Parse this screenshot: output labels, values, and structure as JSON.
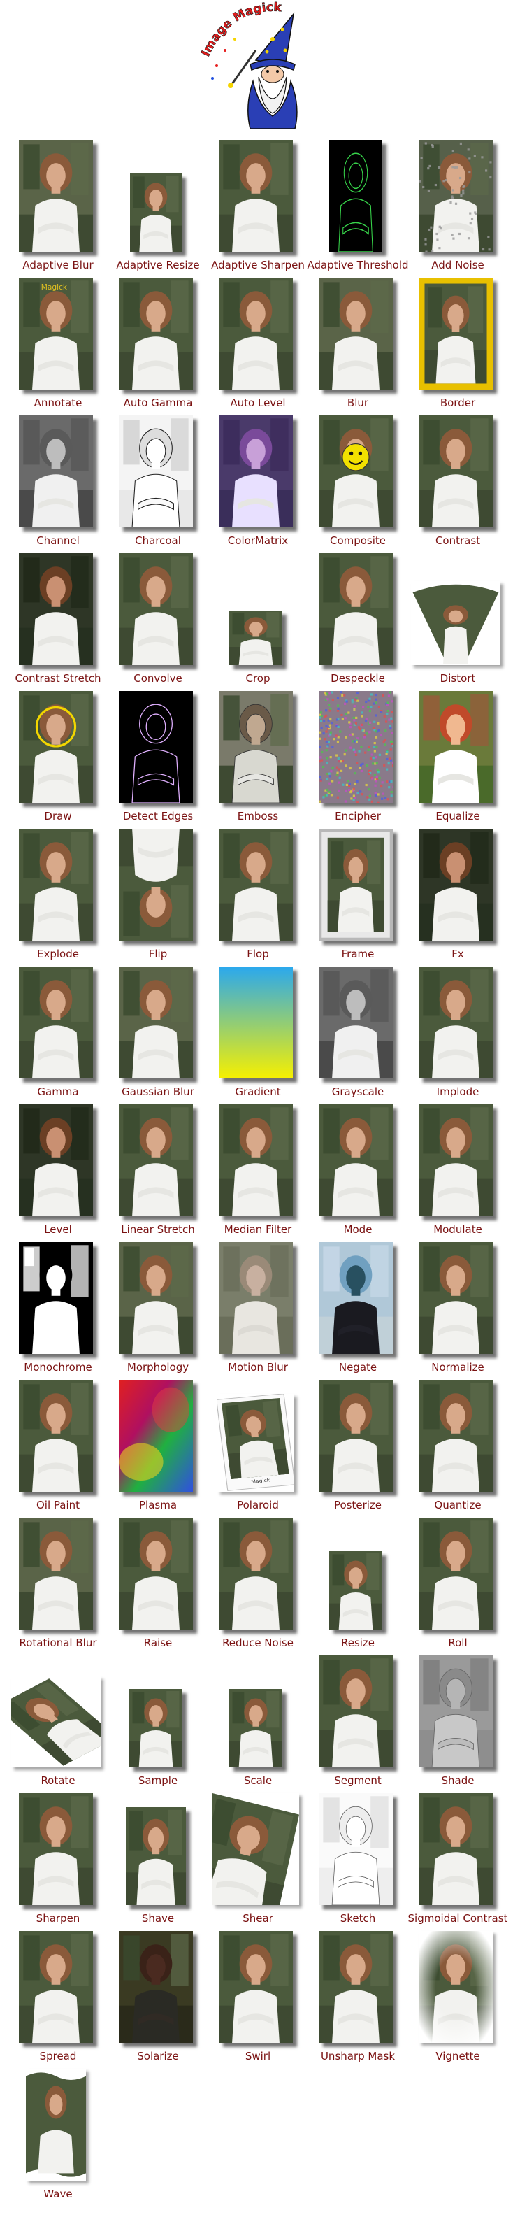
{
  "logo": {
    "text": "Image Magick"
  },
  "effects": [
    {
      "label": "Adaptive Blur",
      "variant": "blur",
      "w": 106,
      "h": 160
    },
    {
      "label": "Adaptive Resize",
      "variant": "photo",
      "w": 74,
      "h": 112
    },
    {
      "label": "Adaptive Sharpen",
      "variant": "photo",
      "w": 106,
      "h": 160
    },
    {
      "label": "Adaptive Threshold",
      "variant": "threshold",
      "w": 76,
      "h": 160
    },
    {
      "label": "Add Noise",
      "variant": "noise",
      "w": 106,
      "h": 160
    },
    {
      "label": "Annotate",
      "variant": "annotate",
      "w": 106,
      "h": 160
    },
    {
      "label": "Auto Gamma",
      "variant": "photo",
      "w": 106,
      "h": 160
    },
    {
      "label": "Auto Level",
      "variant": "photo",
      "w": 106,
      "h": 160
    },
    {
      "label": "Blur",
      "variant": "blur",
      "w": 106,
      "h": 160
    },
    {
      "label": "Border",
      "variant": "border",
      "w": 106,
      "h": 160
    },
    {
      "label": "Channel",
      "variant": "gray",
      "w": 106,
      "h": 160
    },
    {
      "label": "Charcoal",
      "variant": "charcoal",
      "w": 106,
      "h": 160
    },
    {
      "label": "ColorMatrix",
      "variant": "colormatrix",
      "w": 106,
      "h": 160
    },
    {
      "label": "Composite",
      "variant": "composite",
      "w": 106,
      "h": 160
    },
    {
      "label": "Contrast",
      "variant": "photo",
      "w": 106,
      "h": 160
    },
    {
      "label": "Contrast Stretch",
      "variant": "dark",
      "w": 106,
      "h": 160
    },
    {
      "label": "Convolve",
      "variant": "photo",
      "w": 106,
      "h": 160
    },
    {
      "label": "Crop",
      "variant": "photo",
      "w": 76,
      "h": 78
    },
    {
      "label": "Despeckle",
      "variant": "photo",
      "w": 106,
      "h": 160
    },
    {
      "label": "Distort",
      "variant": "distort",
      "w": 128,
      "h": 120
    },
    {
      "label": "Draw",
      "variant": "draw",
      "w": 106,
      "h": 160
    },
    {
      "label": "Detect Edges",
      "variant": "edges",
      "w": 106,
      "h": 160
    },
    {
      "label": "Emboss",
      "variant": "emboss",
      "w": 106,
      "h": 160
    },
    {
      "label": "Encipher",
      "variant": "encipher",
      "w": 106,
      "h": 160
    },
    {
      "label": "Equalize",
      "variant": "equalize",
      "w": 106,
      "h": 160
    },
    {
      "label": "Explode",
      "variant": "photo",
      "w": 106,
      "h": 160
    },
    {
      "label": "Flip",
      "variant": "flip",
      "w": 106,
      "h": 160
    },
    {
      "label": "Flop",
      "variant": "photo",
      "w": 106,
      "h": 160
    },
    {
      "label": "Frame",
      "variant": "frame",
      "w": 106,
      "h": 160
    },
    {
      "label": "Fx",
      "variant": "dark",
      "w": 106,
      "h": 160
    },
    {
      "label": "Gamma",
      "variant": "photo",
      "w": 106,
      "h": 160
    },
    {
      "label": "Gaussian Blur",
      "variant": "blur",
      "w": 106,
      "h": 160
    },
    {
      "label": "Gradient",
      "variant": "gradient",
      "w": 106,
      "h": 160
    },
    {
      "label": "Grayscale",
      "variant": "gray",
      "w": 106,
      "h": 160
    },
    {
      "label": "Implode",
      "variant": "photo",
      "w": 106,
      "h": 160
    },
    {
      "label": "Level",
      "variant": "dark",
      "w": 106,
      "h": 160
    },
    {
      "label": "Linear Stretch",
      "variant": "photo",
      "w": 106,
      "h": 160
    },
    {
      "label": "Median Filter",
      "variant": "photo",
      "w": 106,
      "h": 160
    },
    {
      "label": "Mode",
      "variant": "photo",
      "w": 106,
      "h": 160
    },
    {
      "label": "Modulate",
      "variant": "photo",
      "w": 106,
      "h": 160
    },
    {
      "label": "Monochrome",
      "variant": "mono",
      "w": 106,
      "h": 160
    },
    {
      "label": "Morphology",
      "variant": "blur",
      "w": 106,
      "h": 160
    },
    {
      "label": "Motion Blur",
      "variant": "motion",
      "w": 106,
      "h": 160
    },
    {
      "label": "Negate",
      "variant": "negate",
      "w": 106,
      "h": 160
    },
    {
      "label": "Normalize",
      "variant": "photo",
      "w": 106,
      "h": 160
    },
    {
      "label": "Oil Paint",
      "variant": "photo",
      "w": 106,
      "h": 160
    },
    {
      "label": "Plasma",
      "variant": "plasma",
      "w": 106,
      "h": 160
    },
    {
      "label": "Polaroid",
      "variant": "polaroid",
      "w": 110,
      "h": 140
    },
    {
      "label": "Posterize",
      "variant": "photo",
      "w": 106,
      "h": 160
    },
    {
      "label": "Quantize",
      "variant": "photo",
      "w": 106,
      "h": 160
    },
    {
      "label": "Rotational Blur",
      "variant": "blur",
      "w": 106,
      "h": 160
    },
    {
      "label": "Raise",
      "variant": "photo",
      "w": 106,
      "h": 160
    },
    {
      "label": "Reduce Noise",
      "variant": "photo",
      "w": 106,
      "h": 160
    },
    {
      "label": "Resize",
      "variant": "photo",
      "w": 76,
      "h": 112
    },
    {
      "label": "Roll",
      "variant": "photo",
      "w": 106,
      "h": 160
    },
    {
      "label": "Rotate",
      "variant": "rotate",
      "w": 128,
      "h": 130
    },
    {
      "label": "Sample",
      "variant": "photo",
      "w": 76,
      "h": 112
    },
    {
      "label": "Scale",
      "variant": "photo",
      "w": 76,
      "h": 112
    },
    {
      "label": "Segment",
      "variant": "photo",
      "w": 106,
      "h": 160
    },
    {
      "label": "Shade",
      "variant": "shade",
      "w": 106,
      "h": 160
    },
    {
      "label": "Sharpen",
      "variant": "photo",
      "w": 106,
      "h": 160
    },
    {
      "label": "Shave",
      "variant": "photo",
      "w": 86,
      "h": 140
    },
    {
      "label": "Shear",
      "variant": "shear",
      "w": 124,
      "h": 160
    },
    {
      "label": "Sketch",
      "variant": "sketch",
      "w": 106,
      "h": 160
    },
    {
      "label": "Sigmoidal Contrast",
      "variant": "photo",
      "w": 106,
      "h": 160
    },
    {
      "label": "Spread",
      "variant": "photo",
      "w": 106,
      "h": 160
    },
    {
      "label": "Solarize",
      "variant": "solarize",
      "w": 106,
      "h": 160
    },
    {
      "label": "Swirl",
      "variant": "photo",
      "w": 106,
      "h": 160
    },
    {
      "label": "Unsharp Mask",
      "variant": "photo",
      "w": 106,
      "h": 160
    },
    {
      "label": "Vignette",
      "variant": "vignette",
      "w": 106,
      "h": 160
    },
    {
      "label": "Wave",
      "variant": "wave",
      "w": 86,
      "h": 160
    }
  ]
}
